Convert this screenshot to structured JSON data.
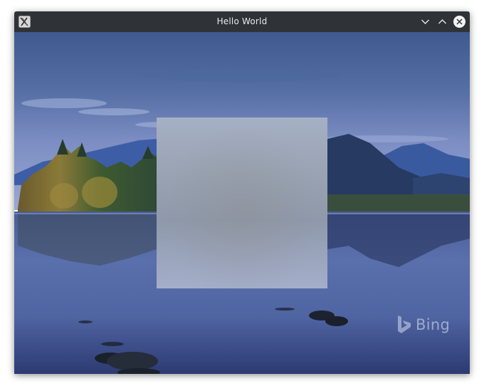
{
  "window": {
    "title": "Hello World",
    "app_icon": "x-window-icon",
    "buttons": [
      {
        "name": "minimize",
        "icon": "chevron-down-icon"
      },
      {
        "name": "maximize",
        "icon": "chevron-up-icon"
      },
      {
        "name": "close",
        "icon": "close-circle-icon"
      }
    ]
  },
  "wallpaper": {
    "watermark": "Bing",
    "watermark_icon": "bing-logo-icon"
  },
  "colors": {
    "titlebar": "#2f3337",
    "title_text": "#e8eaec",
    "sky": "#4a6090",
    "water": "#3a4c86",
    "panel": "#9aa4b6"
  }
}
